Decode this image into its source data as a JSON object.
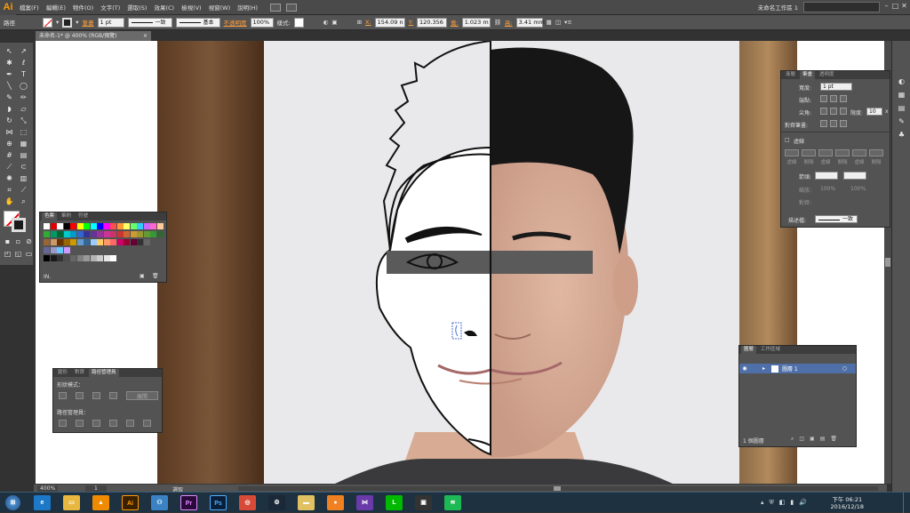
{
  "menubar": {
    "app_logo": "Ai",
    "items": [
      "檔案(F)",
      "編輯(E)",
      "物件(O)",
      "文字(T)",
      "選取(S)",
      "效果(C)",
      "檢視(V)",
      "視窗(W)",
      "說明(H)"
    ],
    "workspace": "未命名工作區 1",
    "search_placeholder": ""
  },
  "controlbar": {
    "selection_label": "路徑",
    "stroke_label": "筆畫",
    "stroke_weight": "1 pt",
    "profile_label": "一致",
    "brush_label": "基本",
    "opacity_label": "不透明度",
    "opacity_value": "100%",
    "style_label": "樣式:",
    "x_label": "X:",
    "x_value": "154.09 n",
    "y_label": "Y:",
    "y_value": "120.356",
    "w_label": "寬:",
    "w_value": "1.023 m",
    "h_label": "高:",
    "h_value": "3.41 mm"
  },
  "document": {
    "tab_title": "未命名-1* @ 400% (RGB/預覽)",
    "close": "×"
  },
  "color_panel": {
    "tabs": [
      "色票",
      "筆刷",
      "符號"
    ],
    "footer_label": "IN."
  },
  "pathfinder_panel": {
    "tabs": [
      "變形",
      "對齊",
      "路徑管理員"
    ],
    "shape_modes_label": "形狀模式：",
    "expand_button": "展開",
    "pathfinders_label": "路徑管理員："
  },
  "stroke_panel": {
    "tabs": [
      "漸層",
      "筆畫",
      "透明度"
    ],
    "weight_label": "寬度:",
    "weight_value": "1 pt",
    "cap_label": "端點:",
    "corner_label": "尖角:",
    "limit_label": "限度:",
    "limit_value": "10",
    "limit_unit": "x",
    "align_label": "對齊筆畫:",
    "dashed_label": "虛線",
    "dash_labels": [
      "虛線",
      "間隔",
      "虛線",
      "間隔",
      "虛線",
      "間隔"
    ],
    "arrow_label": "箭頭:",
    "scale_label": "縮放:",
    "scale_value_1": "100%",
    "scale_value_2": "100%",
    "align_arrow_label": "對齊:",
    "profile_label": "描述檔:",
    "profile_value": "一致"
  },
  "layers_panel": {
    "tabs": [
      "圖層",
      "工作區域"
    ],
    "layer_name": "圖層 1",
    "footer": "1 個圖層"
  },
  "statusbar": {
    "zoom": "400%",
    "page": "1",
    "tool": "選取"
  },
  "taskbar": {
    "time": "下午 06:21",
    "date": "2016/12/18",
    "apps": [
      "ie",
      "file-explorer",
      "vlc",
      "illustrator",
      "chrome-alt",
      "premiere",
      "photoshop",
      "chrome",
      "steam",
      "folder",
      "orange-app",
      "visual-studio",
      "line",
      "capture",
      "spotify"
    ],
    "labels": {
      "illustrator": "Ai",
      "premiere": "Pr",
      "photoshop": "Ps"
    }
  },
  "colors": {
    "accent": "#ff9a00",
    "selection": "#4b6fd6"
  }
}
